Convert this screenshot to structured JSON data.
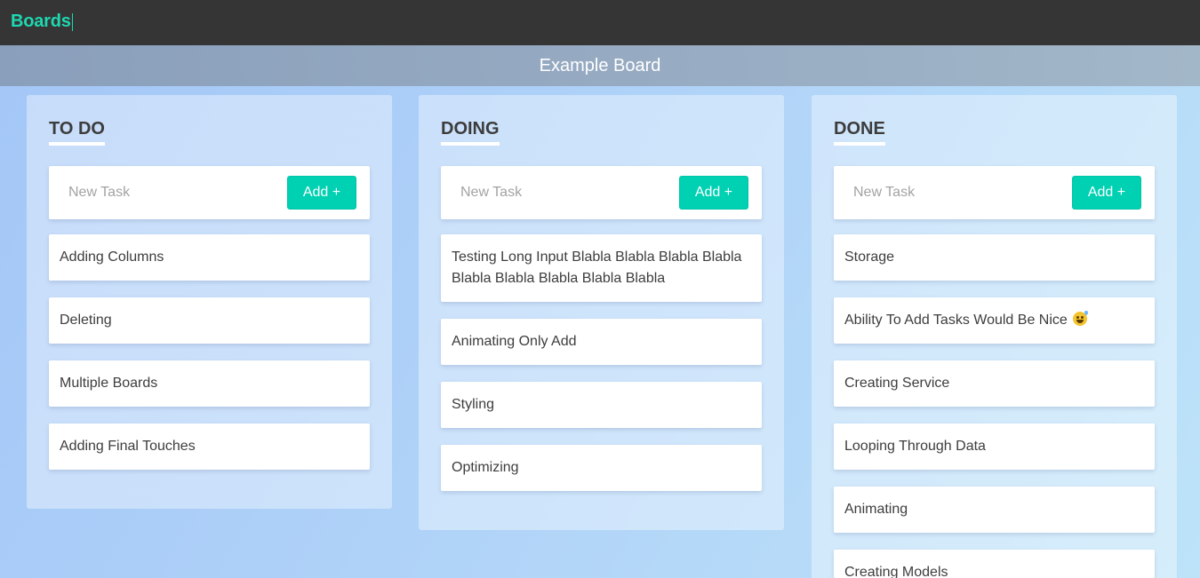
{
  "app": {
    "brand": "Boards"
  },
  "board": {
    "title": "Example Board"
  },
  "columns": [
    {
      "title": "TO DO",
      "new_task_placeholder": "New Task",
      "add_label": "Add +",
      "tasks": [
        "Adding Columns",
        "Deleting",
        "Multiple Boards",
        "Adding Final Touches"
      ]
    },
    {
      "title": "DOING",
      "new_task_placeholder": "New Task",
      "add_label": "Add +",
      "tasks": [
        "Testing Long Input Blabla Blabla Blabla Blabla Blabla Blabla Blabla Blabla Blabla",
        "Animating Only Add",
        "Styling",
        "Optimizing"
      ]
    },
    {
      "title": "DONE",
      "new_task_placeholder": "New Task",
      "add_label": "Add +",
      "tasks": [
        "Storage",
        "Ability To Add Tasks Would Be Nice",
        "Creating Service",
        "Looping Through Data",
        "Animating",
        "Creating Models"
      ]
    }
  ],
  "icons": {
    "sweat-smile": "grinning-face-with-sweat-icon"
  },
  "colors": {
    "accent": "#00d1b2",
    "brand": "#1ed8b0",
    "topbar": "#353535"
  }
}
